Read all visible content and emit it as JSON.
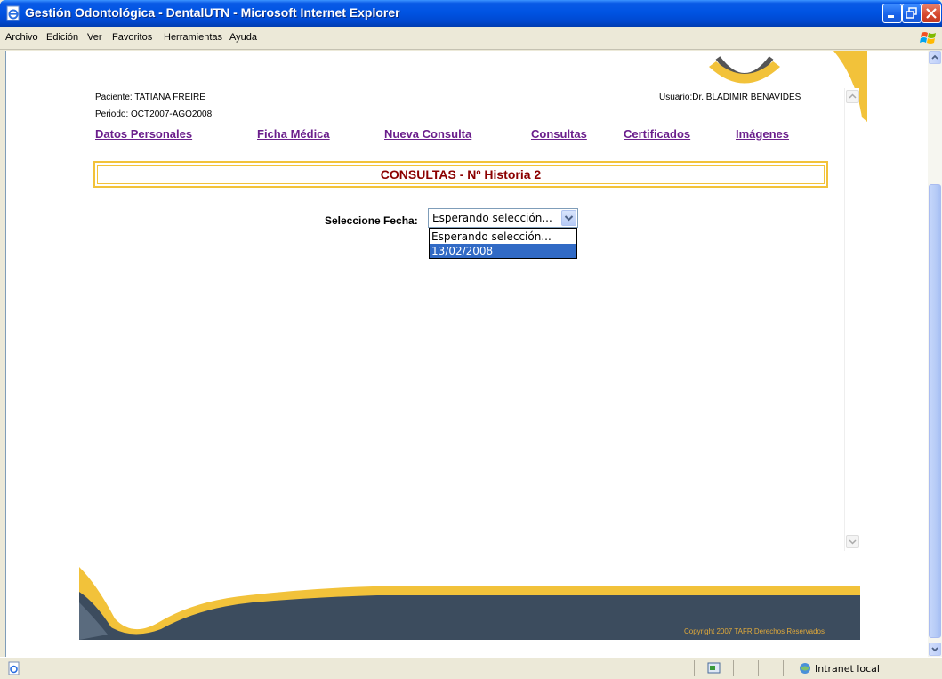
{
  "window": {
    "title": "Gestión Odontológica - DentalUTN - Microsoft Internet Explorer"
  },
  "menu": {
    "items": [
      "Archivo",
      "Edición",
      "Ver",
      "Favoritos",
      "Herramientas",
      "Ayuda"
    ]
  },
  "page": {
    "patient": "Paciente: TATIANA FREIRE",
    "period": "Periodo: OCT2007-AGO2008",
    "user": "Usuario:Dr. BLADIMIR BENAVIDES",
    "nav": [
      "Datos Personales",
      "Ficha Médica",
      "Nueva Consulta",
      "Consultas",
      "Certificados",
      "Imágenes"
    ],
    "section_title": "CONSULTAS - Nº Historia 2",
    "date_label": "Seleccione Fecha:",
    "select_value": "Esperando selección...",
    "options": [
      "Esperando selección...",
      "13/02/2008"
    ],
    "copyright": "Copyright 2007 TAFR Derechos Reservados"
  },
  "status": {
    "zone": "Intranet local"
  },
  "colors": {
    "accent_yellow": "#f2c23a",
    "nav_link": "#6b1f8c",
    "title_text": "#8b0000",
    "selection": "#316ac5"
  }
}
